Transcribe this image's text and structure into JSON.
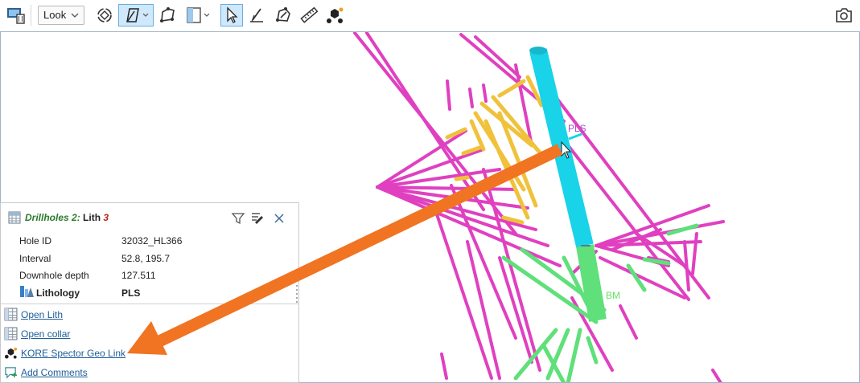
{
  "toolbar": {
    "view_mode": "Look"
  },
  "scene": {
    "labels": [
      {
        "text": "PLS",
        "color": "#a34fcf"
      },
      {
        "text": "BM",
        "color": "#67e067"
      }
    ]
  },
  "panel": {
    "object_name": "Drillholes 2:",
    "table_name": "Lith",
    "table_index": "3",
    "rows": [
      {
        "key": "Hole ID",
        "value": "32032_HL366"
      },
      {
        "key": "Interval",
        "value": "52.8, 195.7"
      },
      {
        "key": "Downhole depth",
        "value": "127.511"
      },
      {
        "key": "Lithology",
        "value": "PLS"
      }
    ],
    "links": [
      {
        "label": "Open Lith",
        "icon": "table-icon"
      },
      {
        "label": "Open collar",
        "icon": "table-icon"
      },
      {
        "label": "KORE Spector Geo Link",
        "icon": "kore-icon"
      },
      {
        "label": "Add Comments",
        "icon": "comment-icon"
      }
    ]
  },
  "colors": {
    "magenta": "#e040c0",
    "yellow": "#f0c23c",
    "green": "#5fe07a",
    "cyan": "#19d3e8",
    "arrow": "#f07422",
    "accent": "#cfe8fb"
  }
}
